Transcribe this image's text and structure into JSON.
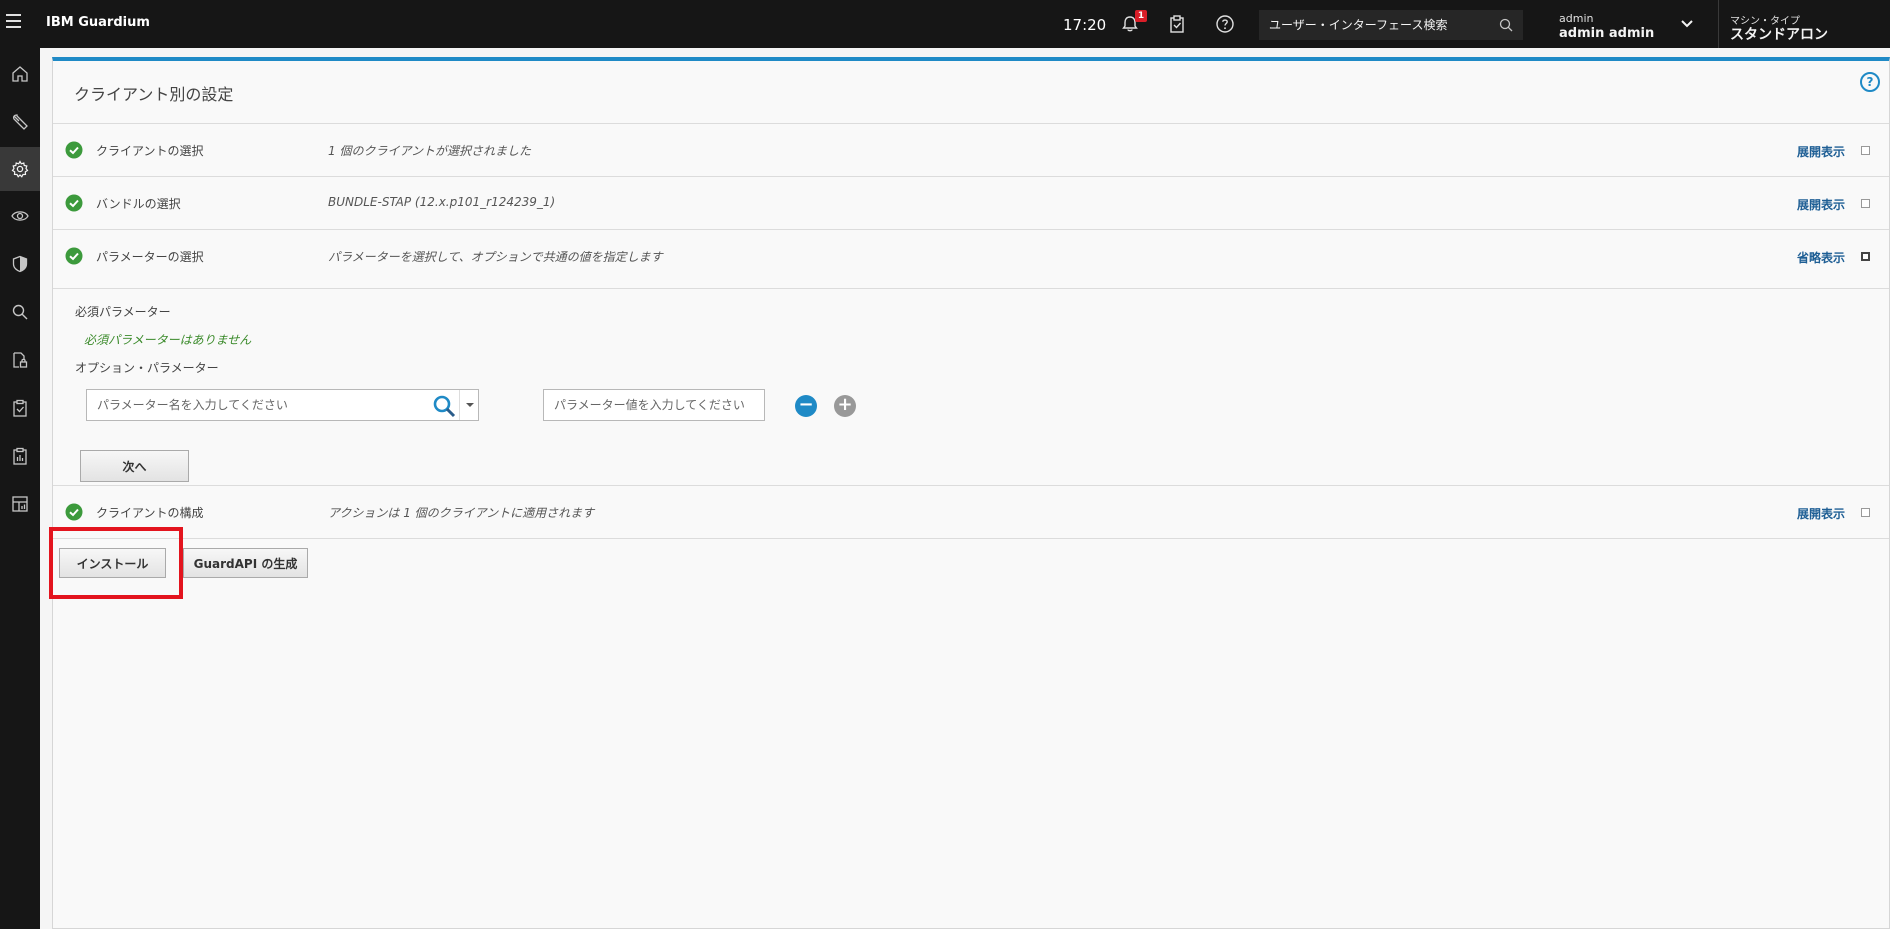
{
  "header": {
    "brand": "IBM Guardium",
    "time": "17:20",
    "notification_count": "1",
    "search_placeholder": "ユーザー・インターフェース検索",
    "user_label": "admin",
    "user_name": "admin admin",
    "machine_type_label": "マシン・タイプ",
    "machine_type_value": "スタンドアロン"
  },
  "sidenav": {
    "items": [
      "home-icon",
      "wrench-icon",
      "gear-icon",
      "eye-icon",
      "shield-icon",
      "search-icon",
      "lock-file-icon",
      "clipboard-check-icon",
      "clipboard-report-icon",
      "dashboard-icon"
    ],
    "active_index": 2
  },
  "page": {
    "title": "クライアント別の設定"
  },
  "steps": [
    {
      "label": "クライアントの選択",
      "desc": "1 個のクライアントが選択されました",
      "toggle": "展開表示"
    },
    {
      "label": "バンドルの選択",
      "desc": "BUNDLE-STAP (12.x.p101_r124239_1)",
      "toggle": "展開表示"
    },
    {
      "label": "パラメーターの選択",
      "desc": "パラメーターを選択して、オプションで共通の値を指定します",
      "toggle": "省略表示"
    },
    {
      "label": "クライアントの構成",
      "desc": "アクションは 1 個のクライアントに適用されます",
      "toggle": "展開表示"
    }
  ],
  "parameters": {
    "required_heading": "必須パラメーター",
    "required_none": "必須パラメーターはありません",
    "optional_heading": "オプション・パラメーター",
    "name_placeholder": "パラメーター名を入力してください",
    "value_placeholder": "パラメーター値を入力してください",
    "next_label": "次へ"
  },
  "actions": {
    "install_label": "インストール",
    "guardapi_label": "GuardAPI の生成"
  },
  "colors": {
    "accent": "#1f8ac6",
    "check_green": "#3c9a3c",
    "highlight_red": "#e3141e"
  }
}
